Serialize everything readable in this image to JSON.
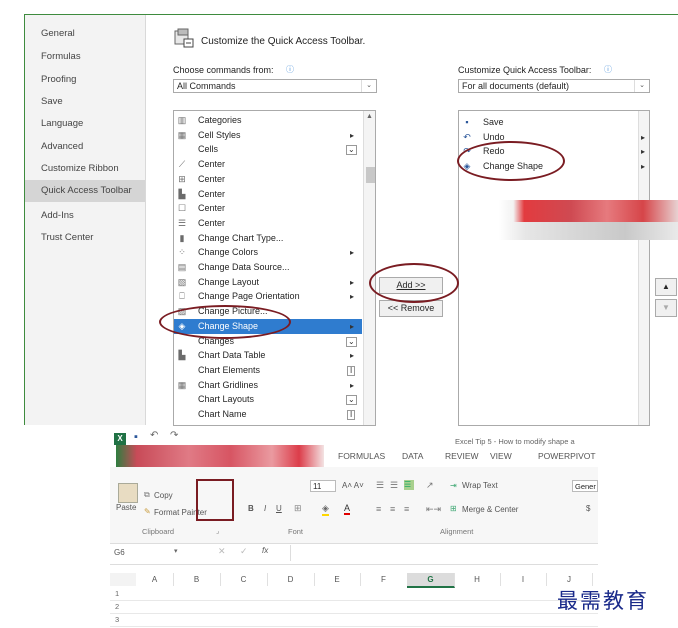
{
  "options_dialog": {
    "nav_items": [
      "General",
      "Formulas",
      "Proofing",
      "Save",
      "Language",
      "Advanced",
      "Customize Ribbon",
      "Quick Access Toolbar",
      "Add-Ins",
      "Trust Center"
    ],
    "selected_nav": "Quick Access Toolbar",
    "section_title": "Customize the Quick Access Toolbar.",
    "choose_label": "Choose commands from:",
    "choose_value": "All Commands",
    "customize_label": "Customize Quick Access Toolbar:",
    "customize_value": "For all documents (default)",
    "commands": [
      {
        "label": "Categories",
        "icon": "categories-icon",
        "glyph": "▥"
      },
      {
        "label": "Cell Styles",
        "icon": "cell-styles-icon",
        "glyph": "▦",
        "sub": "arrow"
      },
      {
        "label": "Cells",
        "icon": "",
        "glyph": "",
        "sub": "dropdown"
      },
      {
        "label": "Center",
        "icon": "center-chart-icon",
        "glyph": "⟋"
      },
      {
        "label": "Center",
        "icon": "center-align-icon",
        "glyph": "⊞"
      },
      {
        "label": "Center",
        "icon": "center-chart2-icon",
        "glyph": "▙"
      },
      {
        "label": "Center",
        "icon": "center-icon",
        "glyph": "☐"
      },
      {
        "label": "Center",
        "icon": "center-lines-icon",
        "glyph": "☰"
      },
      {
        "label": "Change Chart Type...",
        "icon": "chart-type-icon",
        "glyph": "▮"
      },
      {
        "label": "Change Colors",
        "icon": "colors-icon",
        "glyph": "⁘",
        "sub": "arrow"
      },
      {
        "label": "Change Data Source...",
        "icon": "data-source-icon",
        "glyph": "▤"
      },
      {
        "label": "Change Layout",
        "icon": "layout-icon",
        "glyph": "▧",
        "sub": "arrow"
      },
      {
        "label": "Change Page Orientation",
        "icon": "orientation-icon",
        "glyph": "⎕",
        "sub": "arrow"
      },
      {
        "label": "Change Picture...",
        "icon": "picture-icon",
        "glyph": "▨"
      },
      {
        "label": "Change Shape",
        "icon": "change-shape-icon",
        "glyph": "◈",
        "sub": "arrow"
      },
      {
        "label": "Changes",
        "icon": "",
        "glyph": "",
        "sub": "dropdown"
      },
      {
        "label": "Chart Data Table",
        "icon": "data-table-icon",
        "glyph": "▙",
        "sub": "arrow"
      },
      {
        "label": "Chart Elements",
        "icon": "",
        "glyph": "",
        "sub": "cursor"
      },
      {
        "label": "Chart Gridlines",
        "icon": "gridlines-icon",
        "glyph": "▦",
        "sub": "arrow"
      },
      {
        "label": "Chart Layouts",
        "icon": "",
        "glyph": "",
        "sub": "dropdown"
      },
      {
        "label": "Chart Name",
        "icon": "",
        "glyph": "",
        "sub": "cursor"
      }
    ],
    "selected_command": "Change Shape",
    "toolbar_items": [
      {
        "label": "Save",
        "icon": "save-icon",
        "glyph": "▪"
      },
      {
        "label": "Undo",
        "icon": "undo-icon",
        "glyph": "↶"
      },
      {
        "label": "Redo",
        "icon": "redo-icon",
        "glyph": "↷"
      },
      {
        "label": "Change Shape",
        "icon": "change-shape-icon",
        "glyph": "◈"
      }
    ],
    "add_button": "Add >>",
    "remove_button": "<< Remove",
    "highlight_color": "#2f7ccf",
    "annotation_color": "#7a1c22"
  },
  "excel": {
    "title": "Excel Tip 5 - How to modify shape a",
    "tabs": [
      "FORMULAS",
      "DATA",
      "REVIEW",
      "VIEW",
      "POWERPIVOT"
    ],
    "clipboard": {
      "paste": "Paste",
      "copy": "Copy",
      "format_painter": "Format Painter",
      "group": "Clipboard"
    },
    "font": {
      "size": "11",
      "group": "Font",
      "bold": "B",
      "italic": "I",
      "underline": "U"
    },
    "alignment": {
      "wrap_text": "Wrap Text",
      "merge_center": "Merge & Center",
      "group": "Alignment"
    },
    "number": {
      "format": "Gener",
      "currency": "$"
    },
    "name_box": "G6",
    "fx": "fx",
    "columns": [
      "A",
      "B",
      "C",
      "D",
      "E",
      "F",
      "G",
      "H",
      "I",
      "J"
    ],
    "rows": [
      "1",
      "2",
      "3"
    ],
    "selected_column": "G"
  },
  "watermark": "最需教育"
}
